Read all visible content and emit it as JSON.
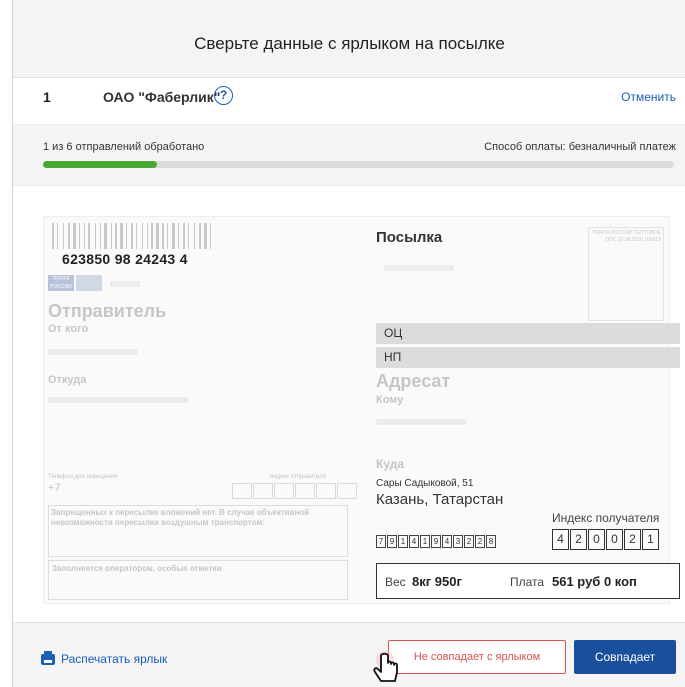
{
  "dialog": {
    "title": "Сверьте данные с ярлыком на посылке"
  },
  "shipment": {
    "number": "1",
    "company": "ОАО \"Фаберлик\"",
    "help_icon": "question-circle-icon",
    "cancel_label": "Отменить"
  },
  "progress": {
    "processed_text": "1 из 6 отправлений обработано",
    "payment_text": "Способ оплаты: безналичный платеж",
    "fraction": 0.18
  },
  "label": {
    "tracking_number": "623850 98 24243 4",
    "logo_text": "ПОЧТА РОССИИ",
    "sender_title": "Отправитель",
    "from_who": "От кого",
    "from_where": "Откуда",
    "phone_label": "Телефон для извещения",
    "phone_code": "+7",
    "sender_index_label": "индекс отправителя",
    "forbidden_text": "Запрещенных к пересылке вложений нет. В случае объективной невозможности пересылки воздушным транспортом:",
    "operator_text": "Заполняется оператором, особые отметки",
    "parcel_title": "Посылка",
    "stamp_text": "ПОЧТА РОССИИ ТЕСТОВОЕ ОПС 29.08.2016 109012",
    "band_oc": "ОЦ",
    "band_np": "НП",
    "addressee_title": "Адресат",
    "to_whom": "Кому",
    "where_to": "Куда",
    "street": "Сары Садыковой, 51",
    "city": "Казань, Татарстан",
    "recipient_index_label": "Индекс получателя",
    "recipient_index_digits": [
      "4",
      "2",
      "0",
      "0",
      "2",
      "1"
    ],
    "phone_digits": [
      "7",
      "9",
      "1",
      "4",
      "1",
      "9",
      "4",
      "3",
      "2",
      "2",
      "8"
    ],
    "weight_label": "Вес",
    "weight_value": "8кг 950г",
    "fee_label": "Плата",
    "fee_value": "561 руб 0 коп"
  },
  "footer": {
    "print_label": "Распечатать ярлык",
    "print_icon": "printer-icon",
    "mismatch_label": "Не совпадает с ярлыком",
    "match_label": "Совпадает",
    "cursor_icon": "hand-pointer-icon"
  },
  "colors": {
    "accent": "#1a4f9c",
    "link": "#1a5fb4",
    "progress": "#4aa832",
    "danger": "#d9534f"
  }
}
